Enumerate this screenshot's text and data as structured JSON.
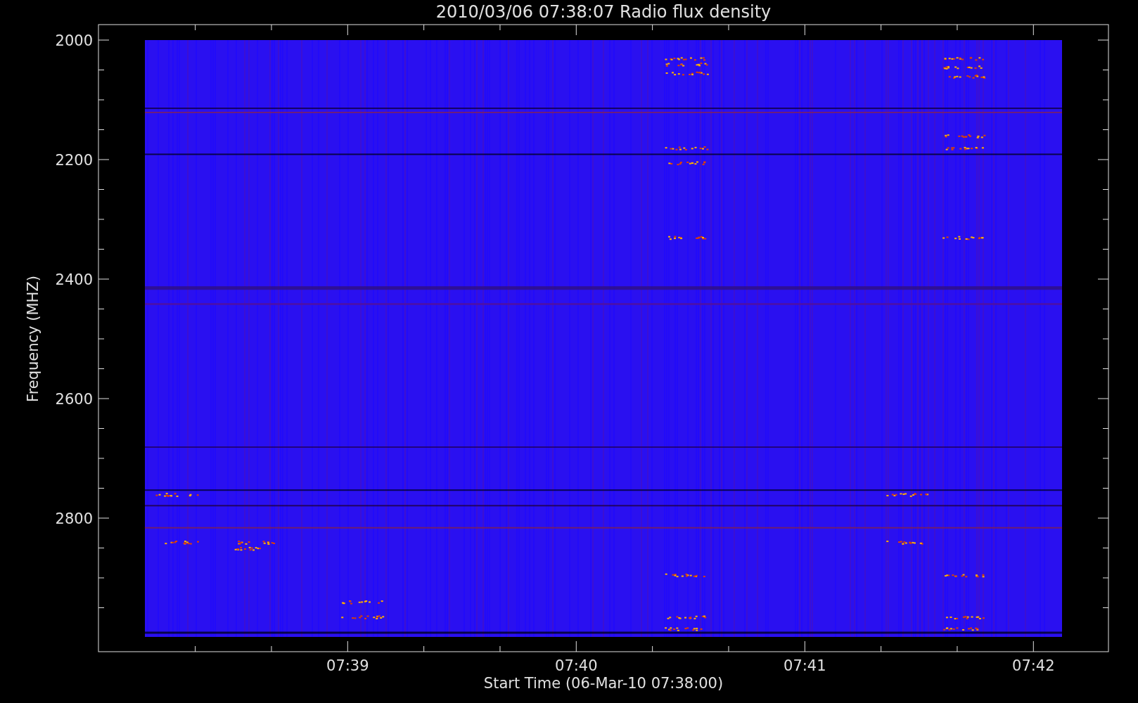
{
  "title": "2010/03/06 07:38:07 Radio flux density",
  "y_axis": {
    "label": "Frequency (MHZ)",
    "tick_labels": [
      "2000",
      "2200",
      "2400",
      "2600",
      "2800"
    ]
  },
  "x_axis": {
    "label": "Start Time (06-Mar-10 07:38:00)",
    "tick_labels": [
      "07:39",
      "07:40",
      "07:41",
      "07:42"
    ]
  }
}
